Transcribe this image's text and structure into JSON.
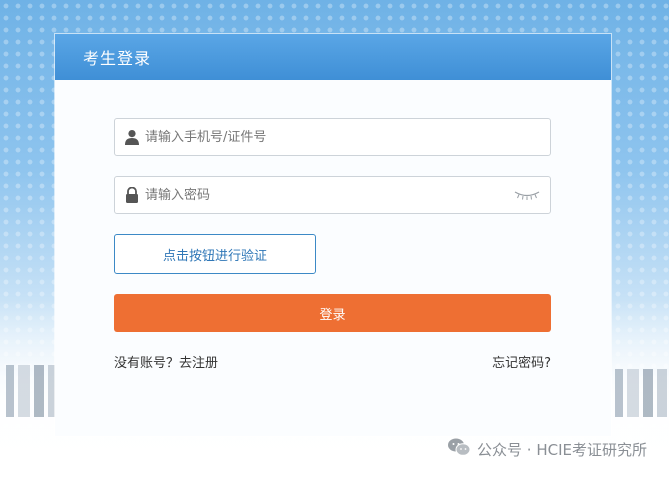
{
  "header": {
    "title": "考生登录"
  },
  "form": {
    "username_placeholder": "请输入手机号/证件号",
    "password_placeholder": "请输入密码",
    "verify_label": "点击按钮进行验证",
    "login_label": "登录"
  },
  "links": {
    "register": "没有账号？去注册",
    "forgot": "忘记密码?"
  },
  "watermark": {
    "text": "公众号 · HCIE考证研究所"
  },
  "icons": {
    "user": "user-icon",
    "lock": "lock-icon",
    "eye": "eye-closed-icon",
    "wechat": "wechat-icon"
  },
  "colors": {
    "header_blue": "#4a9ae0",
    "login_orange": "#ee6f33",
    "verify_border": "#3c89c6"
  }
}
